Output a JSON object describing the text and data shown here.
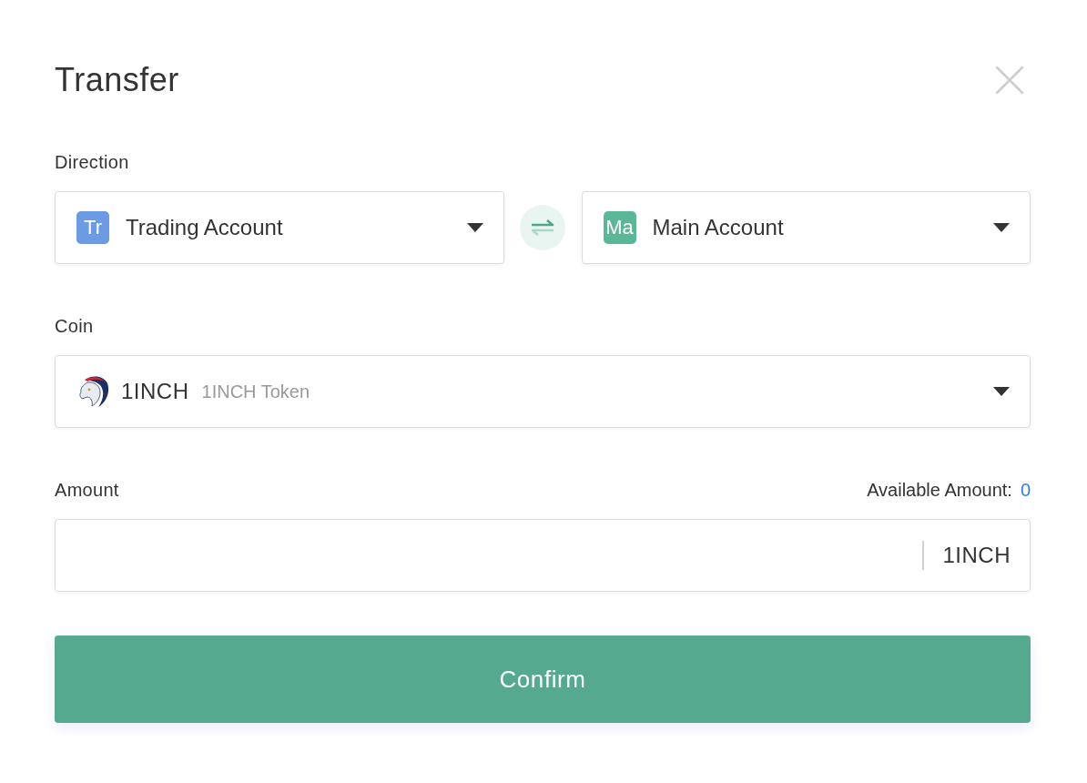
{
  "dialog": {
    "title": "Transfer"
  },
  "direction": {
    "label": "Direction",
    "accounts": [
      {
        "badge": "Tr",
        "color": "#6b9be3",
        "name": "Trading Account"
      },
      {
        "badge": "Ma",
        "color": "#5bb896",
        "name": "Main Account"
      }
    ]
  },
  "coin": {
    "label": "Coin",
    "symbol": "1INCH",
    "name": "1INCH Token"
  },
  "amount": {
    "label": "Amount",
    "available_label": "Available Amount:",
    "available_value": "0",
    "unit": "1INCH"
  },
  "confirm_button": "Confirm"
}
